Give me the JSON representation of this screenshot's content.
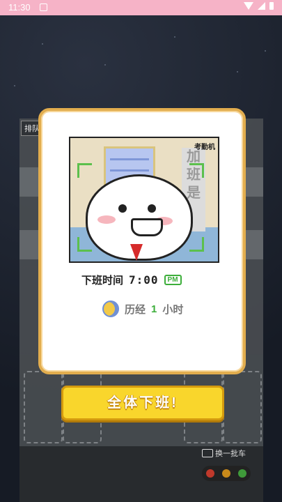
{
  "status_bar": {
    "time": "11:30"
  },
  "scene": {
    "queue_label": "排队",
    "swap_cars_label": "换一批车"
  },
  "dialog": {
    "attendance_machine_label": "考勤机",
    "banner_text": "加班是",
    "off_work_label": "下班时间",
    "off_work_clock": "7:00",
    "meridiem": "PM",
    "elapsed_prefix": "历经",
    "elapsed_hours": "1",
    "elapsed_unit": "小时"
  },
  "actions": {
    "all_off_work_label": "全体下班!"
  },
  "colors": {
    "accent_yellow": "#f9d62c",
    "modal_border": "#e2ad4e",
    "success_green": "#3cae3a",
    "status_bar": "#f6b3c7"
  }
}
